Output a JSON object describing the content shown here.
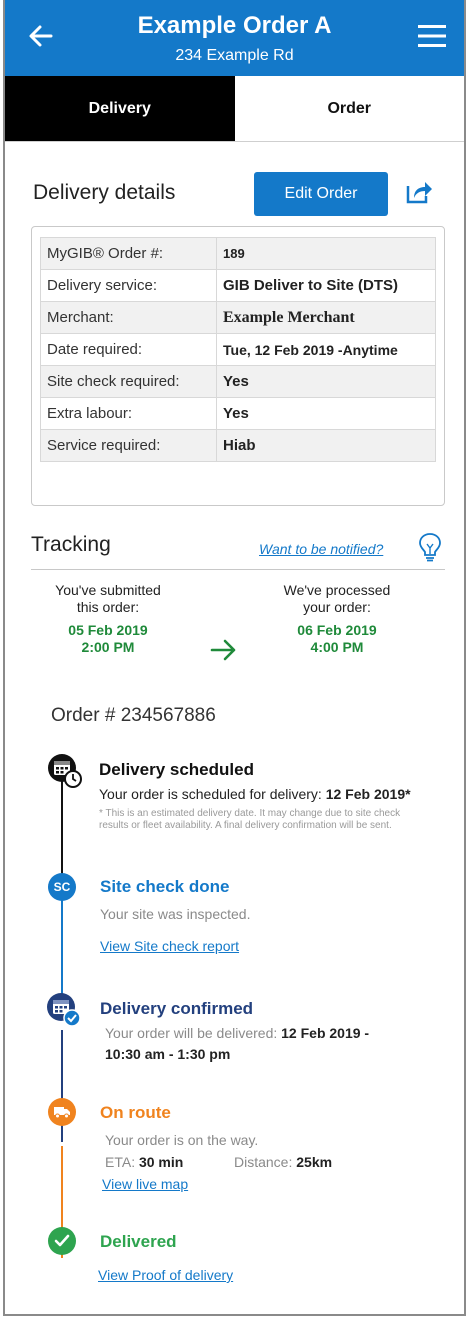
{
  "header": {
    "title": "Example Order A",
    "subtitle": "234 Example Rd"
  },
  "tabs": [
    {
      "label": "Delivery"
    },
    {
      "label": "Order"
    }
  ],
  "details": {
    "title": "Delivery details",
    "edit_label": "Edit Order",
    "rows": [
      {
        "key": "MyGIB® Order #:",
        "value": "189"
      },
      {
        "key": "Delivery service:",
        "value": "GIB Deliver to Site (DTS)"
      },
      {
        "key": "Merchant:",
        "value": "Example Merchant"
      },
      {
        "key": "Date required:",
        "value": "Tue, 12 Feb 2019 -Anytime"
      },
      {
        "key": "Site check required:",
        "value": "Yes"
      },
      {
        "key": "Extra labour:",
        "value": "Yes"
      },
      {
        "key": "Service required:",
        "value": "Hiab"
      }
    ]
  },
  "tracking": {
    "title": "Tracking",
    "notify_link": "Want to be notified?",
    "submitted": {
      "line1": "You've submitted",
      "line2": "this order:",
      "date": "05 Feb 2019",
      "time": "2:00 PM"
    },
    "processed": {
      "line1": "We've processed",
      "line2": "your order:",
      "date": "06 Feb 2019",
      "time": "4:00 PM"
    },
    "order_number": "Order # 234567886"
  },
  "timeline": {
    "scheduled": {
      "title": "Delivery scheduled",
      "text": "Your order is scheduled for delivery:",
      "date": "12 Feb 2019*",
      "note": "* This is an estimated delivery date. It may change due to site check results or fleet availability. A final delivery confirmation will be sent."
    },
    "site_check": {
      "badge": "SC",
      "title": "Site check done",
      "text": "Your site was inspected.",
      "link": "View Site check report"
    },
    "confirmed": {
      "title": "Delivery confirmed",
      "text": "Your order will be delivered:",
      "date": "12 Feb 2019 -",
      "time": "10:30 am - 1:30 pm"
    },
    "on_route": {
      "title": "On route",
      "text": "Your order is on the way.",
      "eta_label": "ETA:",
      "eta_value": "30 min",
      "distance_label": "Distance:",
      "distance_value": "25km",
      "link": "View live map"
    },
    "delivered": {
      "title": "Delivered",
      "link": "View Proof of delivery"
    }
  },
  "colors": {
    "brand_blue": "#1479c9",
    "navy": "#23407e",
    "orange": "#f0831e",
    "green": "#2ea44f",
    "date_green": "#1f8a3a"
  }
}
